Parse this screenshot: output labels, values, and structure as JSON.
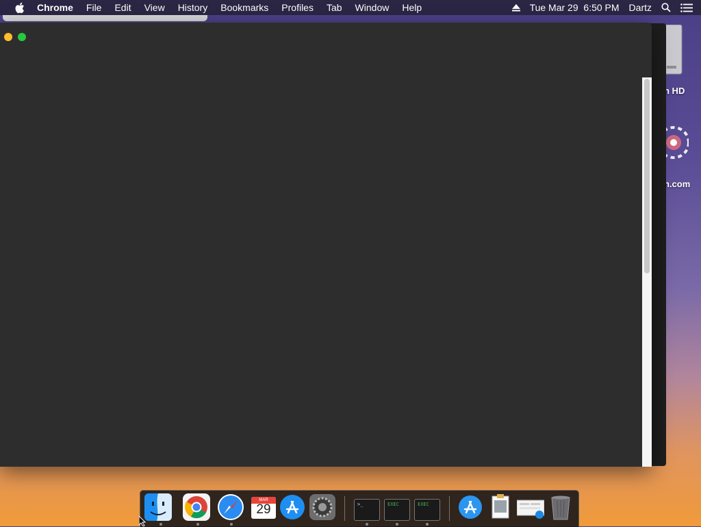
{
  "menubar": {
    "app_name": "Chrome",
    "items": [
      "File",
      "Edit",
      "View",
      "History",
      "Bookmarks",
      "Profiles",
      "Tab",
      "Window",
      "Help"
    ],
    "datetime": "Tue Mar 29  6:50 PM",
    "user": "Dartz",
    "icons": [
      "apple-icon",
      "eject-icon",
      "spotlight-icon",
      "notification-center-icon"
    ]
  },
  "desktop": {
    "icons": [
      {
        "label": "h HD",
        "icon": "hard-drive-icon"
      },
      {
        "label": "n.com",
        "icon": "app-shortcut-icon"
      }
    ]
  },
  "window": {
    "background": "#2d2d2d",
    "traffic_lights": [
      "#febc2e",
      "#28c840"
    ]
  },
  "dock": {
    "apps": [
      {
        "name": "Finder",
        "icon": "finder-icon",
        "running": true
      },
      {
        "name": "Google Chrome",
        "icon": "chrome-icon",
        "running": true
      },
      {
        "name": "Safari",
        "icon": "safari-icon",
        "running": true
      },
      {
        "name": "Calendar",
        "icon": "calendar-icon",
        "month": "MAR",
        "day": "29",
        "running": false
      },
      {
        "name": "App Store",
        "icon": "app-store-icon",
        "running": false
      },
      {
        "name": "System Preferences",
        "icon": "system-preferences-icon",
        "running": false
      },
      {
        "name": "Terminal",
        "icon": "terminal-icon",
        "glyph": ">_",
        "running": true
      },
      {
        "name": "Console",
        "icon": "console-icon",
        "glyph": "EXEC",
        "running": true
      },
      {
        "name": "Console",
        "icon": "console-icon",
        "glyph": "EXEC",
        "running": true
      },
      {
        "name": "Applications",
        "icon": "applications-folder-icon",
        "running": false
      },
      {
        "name": "Preview",
        "icon": "preview-icon",
        "running": false
      },
      {
        "name": "Safari Downloads",
        "icon": "download-stack-icon",
        "running": false
      },
      {
        "name": "Trash",
        "icon": "trash-icon",
        "running": false
      }
    ]
  }
}
